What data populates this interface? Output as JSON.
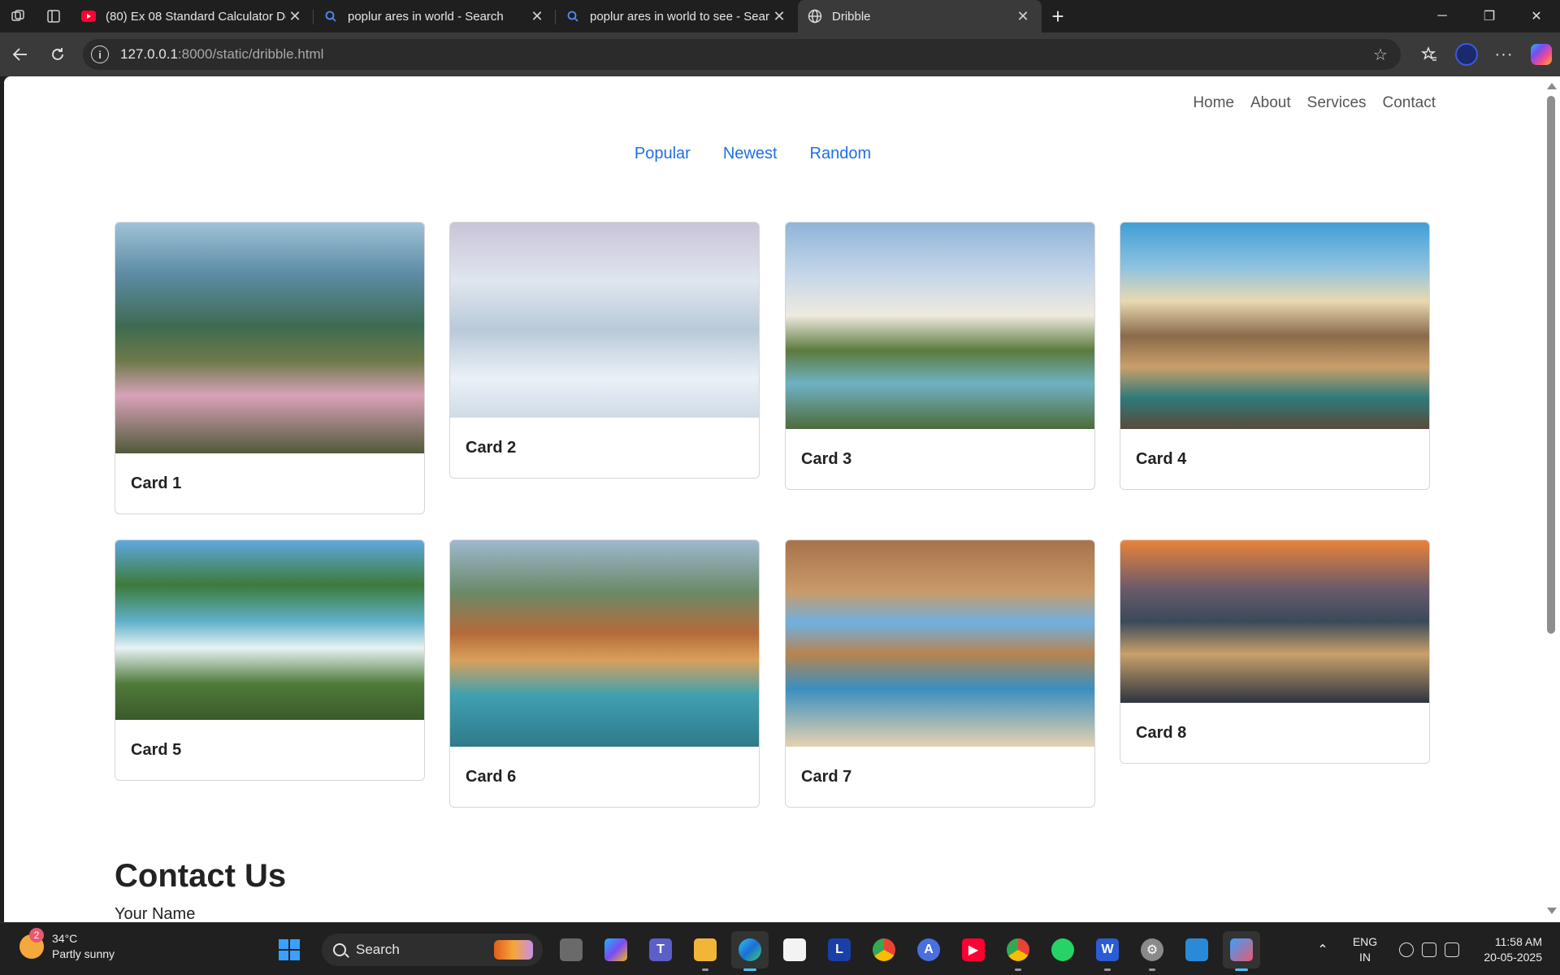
{
  "browser": {
    "tabs": [
      {
        "title": "(80) Ex 08 Standard Calculator De",
        "icon": "youtube-icon"
      },
      {
        "title": "poplur ares in world - Search",
        "icon": "search-icon"
      },
      {
        "title": "poplur ares in world to see - Sear",
        "icon": "search-icon"
      },
      {
        "title": "Dribble",
        "icon": "globe-icon"
      }
    ],
    "active_tab": 3,
    "url_host": "127.0.0.1",
    "url_rest": ":8000/static/dribble.html"
  },
  "page": {
    "nav": [
      "Home",
      "About",
      "Services",
      "Contact"
    ],
    "filters": [
      "Popular",
      "Newest",
      "Random"
    ],
    "cards": [
      {
        "title": "Card 1",
        "image": "mountain-village-photo"
      },
      {
        "title": "Card 2",
        "image": "snowy-cabin-photo"
      },
      {
        "title": "Card 3",
        "image": "taj-mahal-photo"
      },
      {
        "title": "Card 4",
        "image": "mountain-peaks-photo"
      },
      {
        "title": "Card 5",
        "image": "waterfall-photo"
      },
      {
        "title": "Card 6",
        "image": "river-town-photo"
      },
      {
        "title": "Card 7",
        "image": "sea-cave-photo"
      },
      {
        "title": "Card 8",
        "image": "santorini-photo"
      }
    ],
    "contact_heading": "Contact Us",
    "name_label": "Your Name"
  },
  "taskbar": {
    "weather_temp": "34°C",
    "weather_desc": "Partly sunny",
    "weather_badge": "2",
    "search_label": "Search",
    "language": "ENG",
    "region": "IN",
    "time": "11:58 AM",
    "date": "20-05-2025"
  },
  "colors": {
    "link": "#1f6fe5",
    "browser_bg": "#1f1f1f",
    "toolbar_bg": "#3a3a3a",
    "taskbar_bg": "#202020"
  }
}
